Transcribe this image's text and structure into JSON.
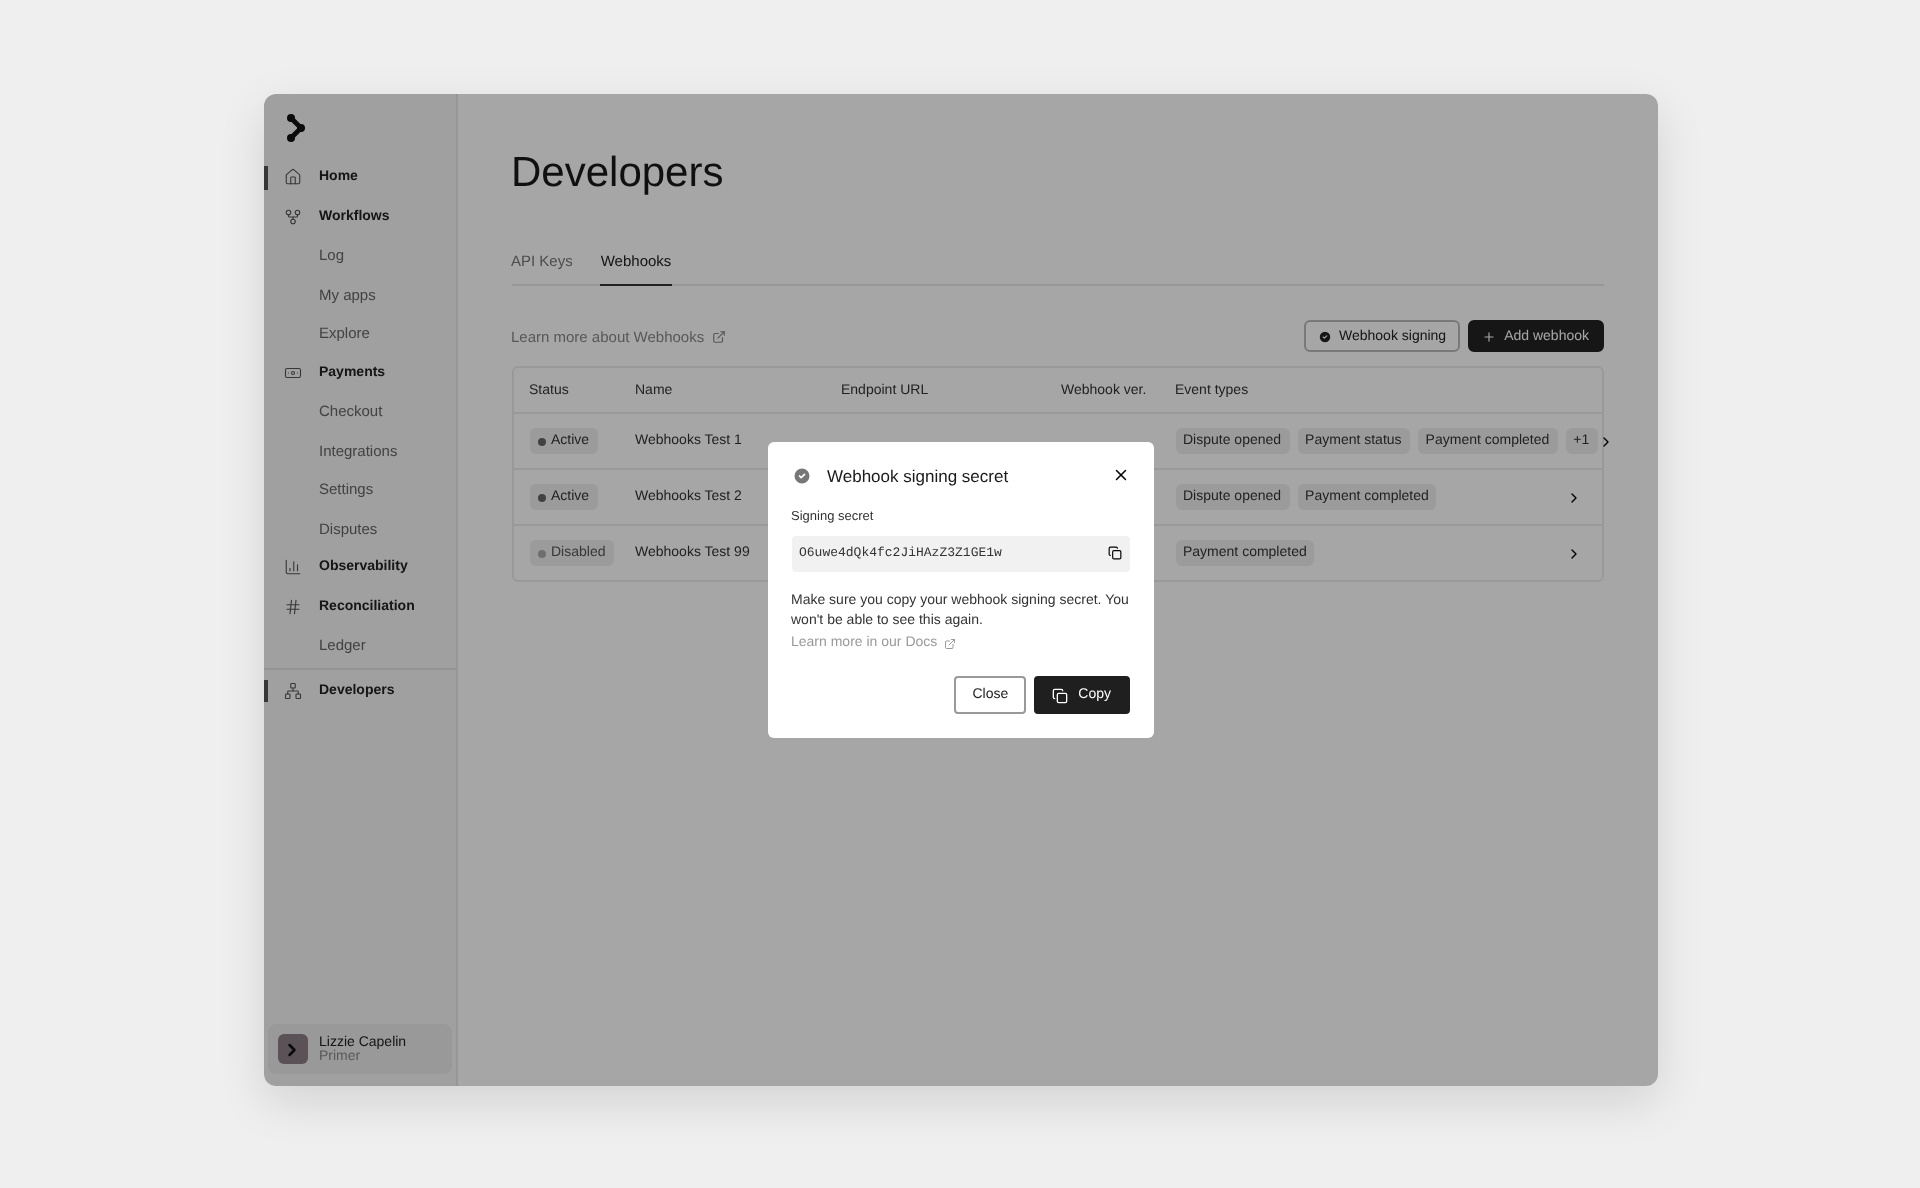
{
  "sidebar": {
    "groups": [
      {
        "label": "Home",
        "selected": true
      },
      {
        "label": "Workflows",
        "selected": false,
        "children": [
          {
            "label": "Log",
            "selected": false
          },
          {
            "label": "My apps",
            "selected": false
          },
          {
            "label": "Explore",
            "selected": false
          }
        ]
      },
      {
        "label": "Payments",
        "selected": false,
        "children": [
          {
            "label": "Checkout",
            "selected": false
          },
          {
            "label": "Integrations",
            "selected": false
          },
          {
            "label": "Settings",
            "selected": false
          },
          {
            "label": "Disputes",
            "selected": false
          }
        ]
      },
      {
        "label": "Observability",
        "selected": false
      },
      {
        "label": "Reconciliation",
        "selected": false,
        "children": [
          {
            "label": "Ledger",
            "selected": false
          }
        ]
      },
      {
        "label": "Developers",
        "selected": true
      }
    ],
    "user": {
      "name": "Lizzie Capelin",
      "org": "Primer"
    }
  },
  "page": {
    "title": "Developers",
    "tabs": [
      {
        "label": "API Keys",
        "selected": false
      },
      {
        "label": "Webhooks",
        "selected": true
      }
    ],
    "learn_link": "Learn more about Webhooks",
    "buttons": [
      {
        "label": "Webhook signing",
        "kind": "secondary"
      },
      {
        "label": "Add webhook",
        "kind": "primary"
      }
    ]
  },
  "table": {
    "columns": [
      "Status",
      "Name",
      "Endpoint URL",
      "Webhook ver.",
      "Event types"
    ],
    "rows": [
      {
        "status": {
          "label": "Active",
          "kind": "active"
        },
        "name": "Webhooks Test 1",
        "events": [
          "Dispute opened",
          "Payment status",
          "Payment completed",
          "+1"
        ]
      },
      {
        "status": {
          "label": "Active",
          "kind": "active"
        },
        "name": "Webhooks Test 2",
        "events": [
          "Dispute opened",
          "Payment completed"
        ]
      },
      {
        "status": {
          "label": "Disabled",
          "kind": "disabled"
        },
        "name": "Webhooks Test 99",
        "events": [
          "Payment completed"
        ]
      }
    ]
  },
  "dialog": {
    "title": "Webhook signing secret",
    "field_label": "Signing secret",
    "secret": "O6uwe4dQk4fc2JiHAzZ3Z1GE1w",
    "message": "Make sure you copy your webhook signing secret. You won't be able to see this again.",
    "docs_link": "Learn more in our Docs",
    "buttons": [
      {
        "label": "Close",
        "kind": "secondary"
      },
      {
        "label": "Copy",
        "kind": "primary"
      }
    ]
  }
}
